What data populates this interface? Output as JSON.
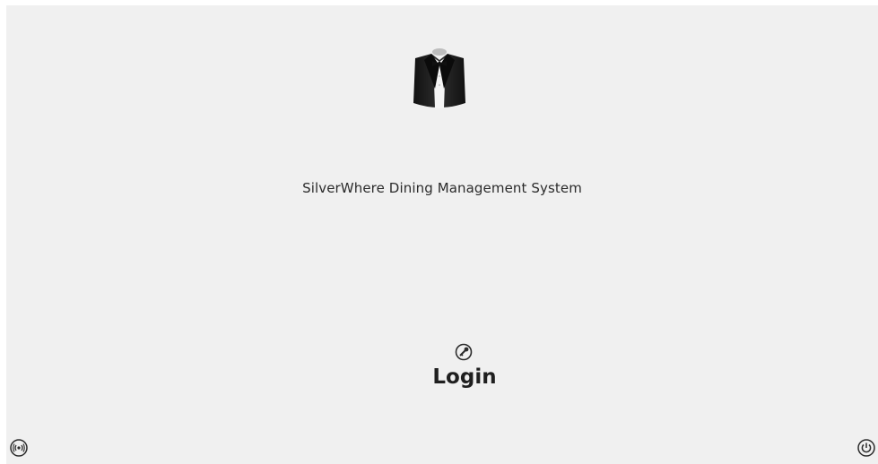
{
  "app": {
    "title": "SilverWhere Dining Management System",
    "logo_icon": "tuxedo-icon"
  },
  "login": {
    "label": "Login",
    "icon": "key-icon"
  },
  "corners": {
    "left_icon": "wireless-icon",
    "right_icon": "power-icon"
  },
  "colors": {
    "background": "#f0f0f0",
    "text": "#2b2b2b",
    "logo_jacket": "#1c1c1c"
  }
}
